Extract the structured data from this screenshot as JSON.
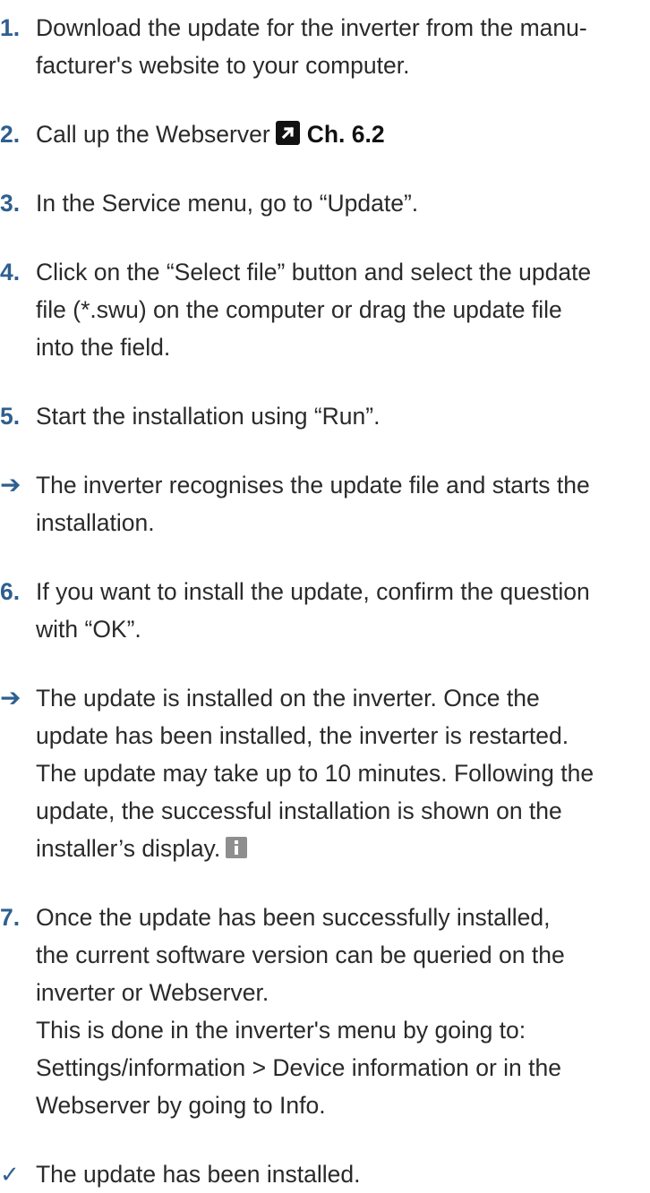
{
  "steps": [
    {
      "marker": "1.",
      "kind": "step",
      "text": "Download the update for the inverter from the manu-\nfacturer's website to your computer."
    },
    {
      "marker": "2.",
      "kind": "step",
      "text": "Call up the Webserver",
      "xref_label": "Ch. 6.2",
      "xref_icon": "external-link-icon"
    },
    {
      "marker": "3.",
      "kind": "step",
      "text": "In the Service menu, go to “Update”."
    },
    {
      "marker": "4.",
      "kind": "step",
      "text": "Click on the “Select file” button and select the update\nfile (*.swu) on the computer or drag the update file\ninto the field."
    },
    {
      "marker": "5.",
      "kind": "step",
      "text": "Start the installation using “Run”."
    },
    {
      "marker": "➔",
      "kind": "result",
      "text": "The inverter recognises the update file and starts the\ninstallation."
    },
    {
      "marker": "6.",
      "kind": "step",
      "text": "If you want to install the update, confirm the question\nwith “OK”."
    },
    {
      "marker": "➔",
      "kind": "result",
      "text": "The update is installed on the inverter. Once the\nupdate has been installed, the inverter is restarted.\nThe update may take up to 10 minutes. Following the\nupdate, the successful installation is shown on the\ninstaller’s display.",
      "info_icon": "info-icon"
    },
    {
      "marker": "7.",
      "kind": "step",
      "text": "Once the update has been successfully installed,\nthe current software version can be queried on the\ninverter or Webserver.\nThis is done in the inverter's menu by going to:\nSettings/information > Device information or in the\nWebserver by going to Info."
    },
    {
      "marker": "✓",
      "kind": "final",
      "text": "The update has been installed."
    }
  ],
  "colors": {
    "marker": "#2f5f8f",
    "text": "#2a2a2a",
    "xref_icon_bg": "#111111",
    "info_icon_bg": "#8e8e8e"
  }
}
